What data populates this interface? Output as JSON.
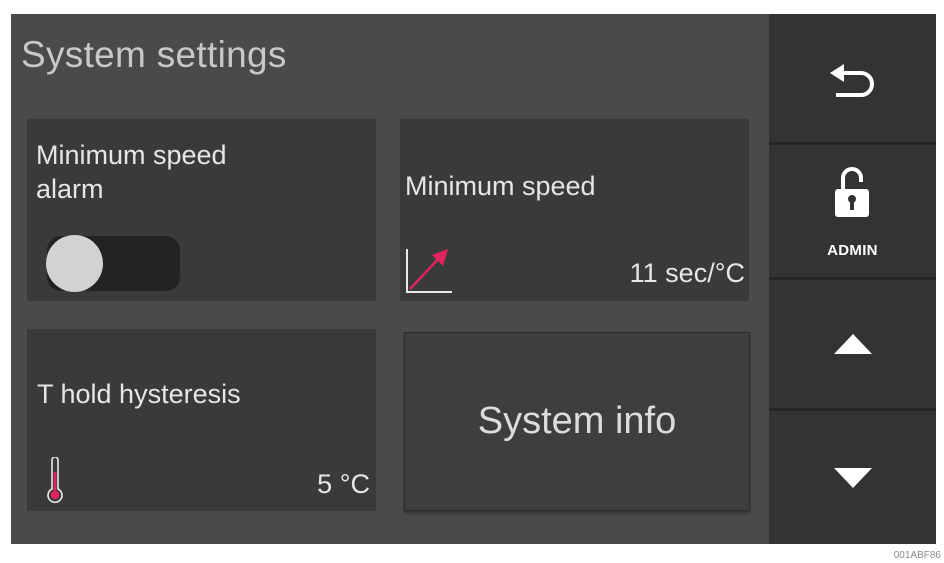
{
  "header": {
    "title": "System settings"
  },
  "tiles": {
    "min_speed_alarm": {
      "label": "Minimum speed\nalarm",
      "toggle_state": "off"
    },
    "min_speed": {
      "label": "Minimum speed",
      "value": "11 sec/°C",
      "icon": "ramp-arrow-icon"
    },
    "t_hold": {
      "label": "T hold hysteresis",
      "value": "5 °C",
      "icon": "thermometer-icon"
    },
    "system_info": {
      "label": "System info"
    }
  },
  "sidebar": {
    "back_icon": "back-arrow-icon",
    "admin": {
      "label": "ADMIN",
      "icon": "unlocked-padlock-icon"
    },
    "up_icon": "triangle-up-icon",
    "down_icon": "triangle-down-icon"
  },
  "colors": {
    "accent_red": "#e0245e",
    "background": "#4a4a4a",
    "tile": "#3a3a3a",
    "rail": "#252525"
  },
  "figure_code": "001ABF86"
}
